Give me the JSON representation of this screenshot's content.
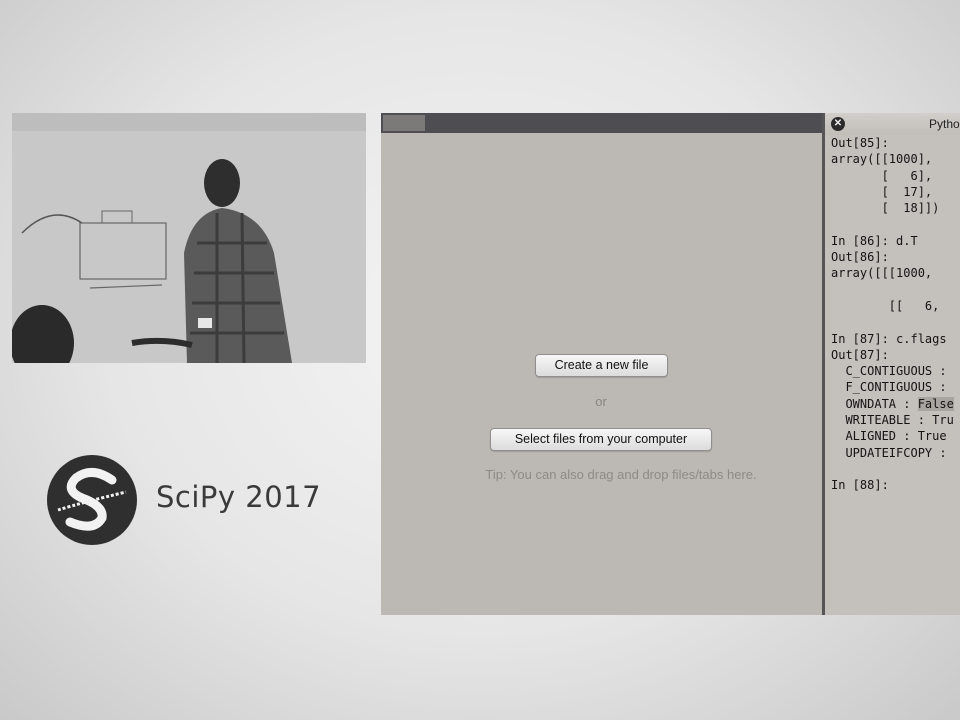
{
  "brand": {
    "logo_icon": "scipy-logo-icon",
    "name": "SciPy 2017"
  },
  "app": {
    "tab_label": "",
    "create_button": "Create a new file",
    "or_text": "or",
    "select_button": "Select files from your computer",
    "tip_text": "Tip: You can also drag and drop files/tabs here."
  },
  "console": {
    "title": "Pytho",
    "close_icon": "close-icon",
    "lines": [
      "Out[85]:",
      "array([[1000],",
      "       [   6],",
      "       [  17],",
      "       [  18]])",
      "",
      "In [86]: d.T",
      "Out[86]:",
      "array([[[1000,",
      "",
      "        [[   6,",
      "",
      "In [87]: c.flags",
      "Out[87]:",
      "  C_CONTIGUOUS :",
      "  F_CONTIGUOUS :",
      "  OWNDATA : ",
      "  WRITEABLE : Tru",
      "  ALIGNED : True",
      "  UPDATEIFCOPY :",
      "",
      "In [88]:"
    ],
    "highlight_word": "False"
  },
  "colors": {
    "app_bg": "#bcb8b3",
    "topbar": "#4d4d52",
    "console_bg": "#c4c0bc"
  }
}
